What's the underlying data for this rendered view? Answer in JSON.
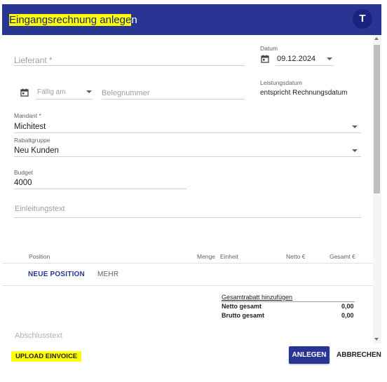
{
  "colors": {
    "header_bg": "#283593",
    "highlight": "#ffff00",
    "accent": "#283593"
  },
  "header": {
    "title_highlighted": "Eingangsrechnung anlege",
    "title_rest": "n",
    "avatar_initial": "T"
  },
  "form": {
    "lieferant_placeholder": "Lieferant *",
    "datum_label": "Datum",
    "datum_value": "09.12.2024",
    "faellig_placeholder": "Fällig am",
    "belegnummer_placeholder": "Belegnummer",
    "leistungsdatum_label": "Leistungsdatum",
    "leistungsdatum_value": "entspricht Rechnungsdatum",
    "mandant_label": "Mandant *",
    "mandant_value": "Michitest",
    "rabattgruppe_label": "Rabattgruppe",
    "rabattgruppe_value": "Neu Kunden",
    "budget_label": "Budget",
    "budget_value": "4000",
    "einleitungstext_placeholder": "Einleitungstext",
    "abschlusstext_placeholder": "Abschlusstext"
  },
  "table": {
    "headers": {
      "position": "Position",
      "menge": "Menge",
      "einheit": "Einheit",
      "netto": "Netto €",
      "gesamt": "Gesamt €"
    },
    "new_position_label": "NEUE POSITION",
    "more_label": "MEHR"
  },
  "summary": {
    "discount_link": "Gesamtrabatt hinzufügen",
    "netto_label": "Netto gesamt",
    "netto_value": "0,00",
    "brutto_label": "Brutto gesamt",
    "brutto_value": "0,00"
  },
  "actions": {
    "upload_label": "UPLOAD EINVOICE",
    "create_label": "ANLEGEN",
    "cancel_label": "ABBRECHEN"
  },
  "icons": {
    "calendar": "calendar-icon",
    "dropdown": "caret-down-icon"
  }
}
